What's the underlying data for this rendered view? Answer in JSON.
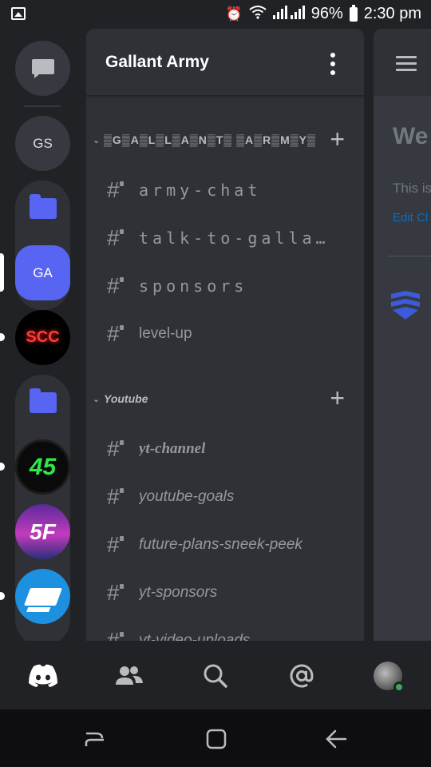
{
  "status_bar": {
    "battery": "96%",
    "time": "2:30 pm"
  },
  "servers": [
    {
      "name": "direct-messages",
      "label": ""
    },
    {
      "name": "gs",
      "label": "GS"
    },
    {
      "name": "folder-1",
      "label": ""
    },
    {
      "name": "ga",
      "label": "GA"
    },
    {
      "name": "scc",
      "label": "SCC"
    },
    {
      "name": "folder-2",
      "label": ""
    },
    {
      "name": "45",
      "label": "45"
    },
    {
      "name": "5f",
      "label": "5F"
    },
    {
      "name": "bench",
      "label": ""
    }
  ],
  "guild": {
    "name": "Gallant Army"
  },
  "categories": [
    {
      "name": "▒G▒A▒L▒L▒A▒N▒T▒ ▒A▒R▒M▒Y▒",
      "channels": [
        "army-chat",
        "talk-to-galla…",
        "sponsors",
        "level-up"
      ]
    },
    {
      "name": "Youtube",
      "channels": [
        "yt-channel",
        "youtube-goals",
        "future-plans-sneek-peek",
        "yt-sponsors",
        "yt-video-uploads"
      ]
    }
  ],
  "peek": {
    "welcome": "We",
    "this": "This is",
    "edit": "Edit Cl"
  },
  "colors": {
    "blurple": "#5865f2",
    "online": "#3ba55c",
    "link": "#0b6ebd"
  }
}
